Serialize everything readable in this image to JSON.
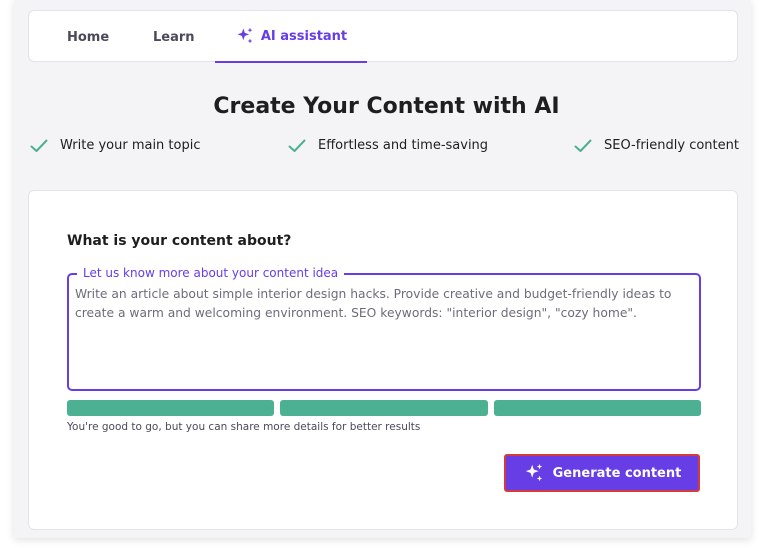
{
  "nav": {
    "tabs": [
      {
        "label": "Home",
        "active": false
      },
      {
        "label": "Learn",
        "active": false
      },
      {
        "label": "AI assistant",
        "active": true,
        "icon": "sparkles-icon"
      }
    ]
  },
  "page": {
    "title": "Create Your Content with AI"
  },
  "features": [
    {
      "icon": "check-icon",
      "label": "Write your main topic"
    },
    {
      "icon": "check-icon",
      "label": "Effortless and time-saving"
    },
    {
      "icon": "check-icon",
      "label": "SEO-friendly content"
    }
  ],
  "form": {
    "question": "What is your content about?",
    "field_label": "Let us know more about your content idea",
    "field_value": "Write an article about simple interior design hacks. Provide creative and budget-friendly ideas to create a warm and welcoming environment. SEO keywords: \"interior design\", \"cozy home\".",
    "progress": {
      "filled_segments": 3,
      "total_segments": 3
    },
    "hint": "You're good to go, but you can share more details for better results",
    "generate_label": "Generate content",
    "generate_icon": "sparkles-icon"
  },
  "colors": {
    "accent": "#673de6",
    "success": "#4cb093",
    "button_outline": "#d63b3b"
  }
}
